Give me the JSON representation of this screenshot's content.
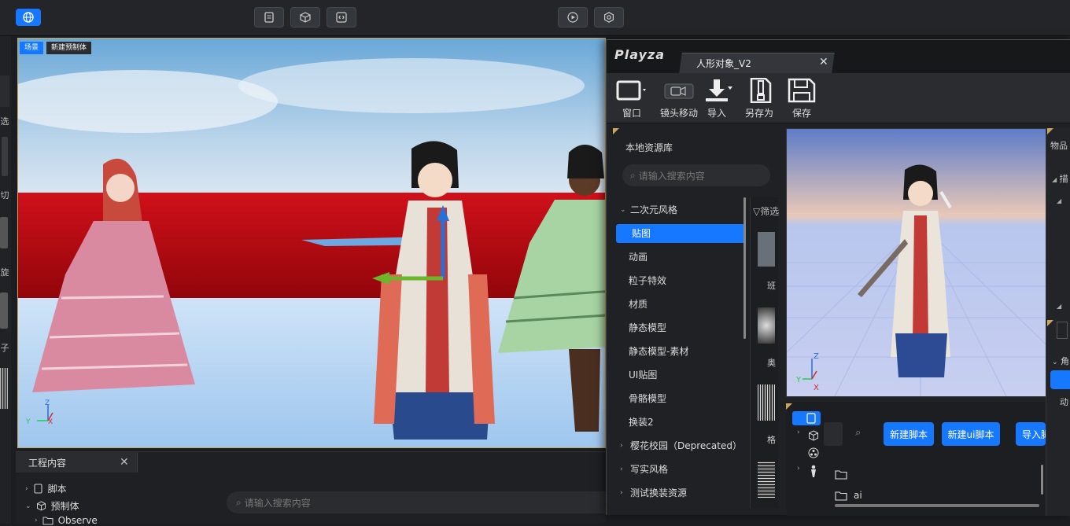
{
  "viewport": {
    "tabs": [
      "场景",
      "新建预制体"
    ]
  },
  "left_strip": {
    "chars": [
      "选",
      "切",
      "旋",
      "缩",
      "子"
    ]
  },
  "project": {
    "tab_label": "工程内容",
    "tree": [
      {
        "label": "脚本",
        "icon": "script-icon",
        "expanded": false
      },
      {
        "label": "预制体",
        "icon": "cube-icon",
        "expanded": true
      },
      {
        "label": "Observe",
        "icon": "folder-icon",
        "expanded": false
      }
    ],
    "search_placeholder": "请输入搜索内容"
  },
  "playza": {
    "logo": "Playza",
    "tab_label": "人形对象_V2",
    "toolbar": [
      {
        "label": "窗口",
        "icon": "window-icon"
      },
      {
        "label": "镜头移动",
        "icon": "camera-icon"
      },
      {
        "label": "导入",
        "icon": "download-icon"
      },
      {
        "label": "另存为",
        "icon": "save-as-icon"
      },
      {
        "label": "保存",
        "icon": "floppy-disk-icon"
      }
    ],
    "library": {
      "title": "本地资源库",
      "search_placeholder": "请输入搜索内容",
      "filter_label": "筛选",
      "groups": [
        {
          "label": "二次元风格",
          "expanded": true,
          "children": [
            "贴图",
            "动画",
            "粒子特效",
            "材质",
            "静态模型",
            "静态模型-素材",
            "UI贴图",
            "骨骼模型",
            "换装2"
          ],
          "selected": "贴图"
        },
        {
          "label": "樱花校园（Deprecated）",
          "expanded": false
        },
        {
          "label": "写实风格",
          "expanded": false
        },
        {
          "label": "测试换装资源",
          "expanded": false
        }
      ],
      "thumb_labels": [
        "班",
        "奥",
        "格"
      ]
    },
    "scripts": {
      "buttons": [
        "新建脚本",
        "新建ui脚本",
        "导入脚本"
      ],
      "folders": [
        "",
        "ai"
      ]
    },
    "right_panel": {
      "title": "物品",
      "items": [
        "描",
        "角",
        "动"
      ]
    }
  },
  "colors": {
    "accent": "#1677ff",
    "border_gold": "#c9a65a"
  }
}
